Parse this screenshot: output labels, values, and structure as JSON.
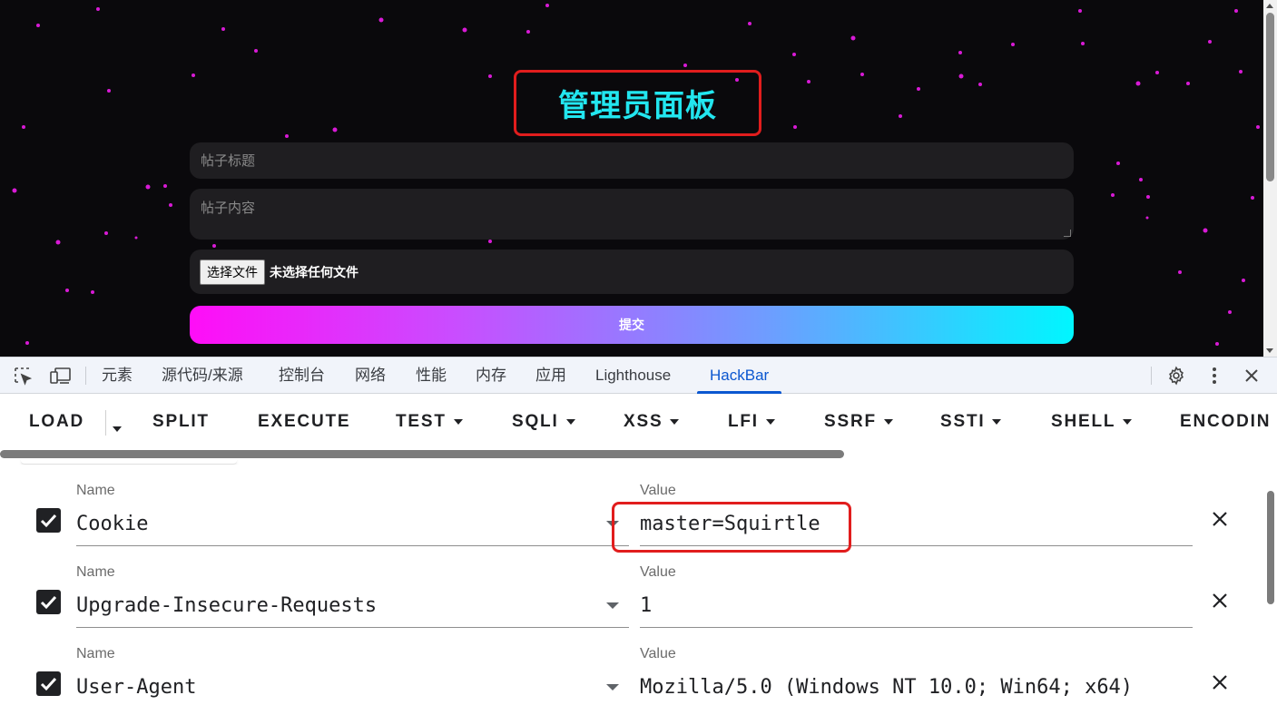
{
  "page": {
    "title": "管理员面板",
    "title_input_placeholder": "帖子标题",
    "content_input_placeholder": "帖子内容",
    "file_button_label": "选择文件",
    "file_status": "未选择任何文件",
    "submit_label": "提交"
  },
  "devtools": {
    "tabs": [
      "元素",
      "源代码/来源",
      "控制台",
      "网络",
      "性能",
      "内存",
      "应用",
      "Lighthouse",
      "HackBar"
    ],
    "active_tab": "HackBar"
  },
  "hackbar": {
    "toolbar": [
      "LOAD",
      "SPLIT",
      "EXECUTE",
      "TEST",
      "SQLI",
      "XSS",
      "LFI",
      "SSRF",
      "SSTI",
      "SHELL",
      "ENCODIN"
    ],
    "name_label": "Name",
    "value_label": "Value",
    "headers": [
      {
        "enabled": true,
        "name": "Cookie",
        "value": "master=Squirtle"
      },
      {
        "enabled": true,
        "name": "Upgrade-Insecure-Requests",
        "value": "1"
      },
      {
        "enabled": true,
        "name": "User-Agent",
        "value": "Mozilla/5.0 (Windows NT 10.0; Win64; x64)"
      }
    ]
  },
  "colors": {
    "title": "#22e6ef",
    "highlight": "#e11d1d",
    "active_tab": "#0b57d0",
    "star": "#d81ad6"
  }
}
